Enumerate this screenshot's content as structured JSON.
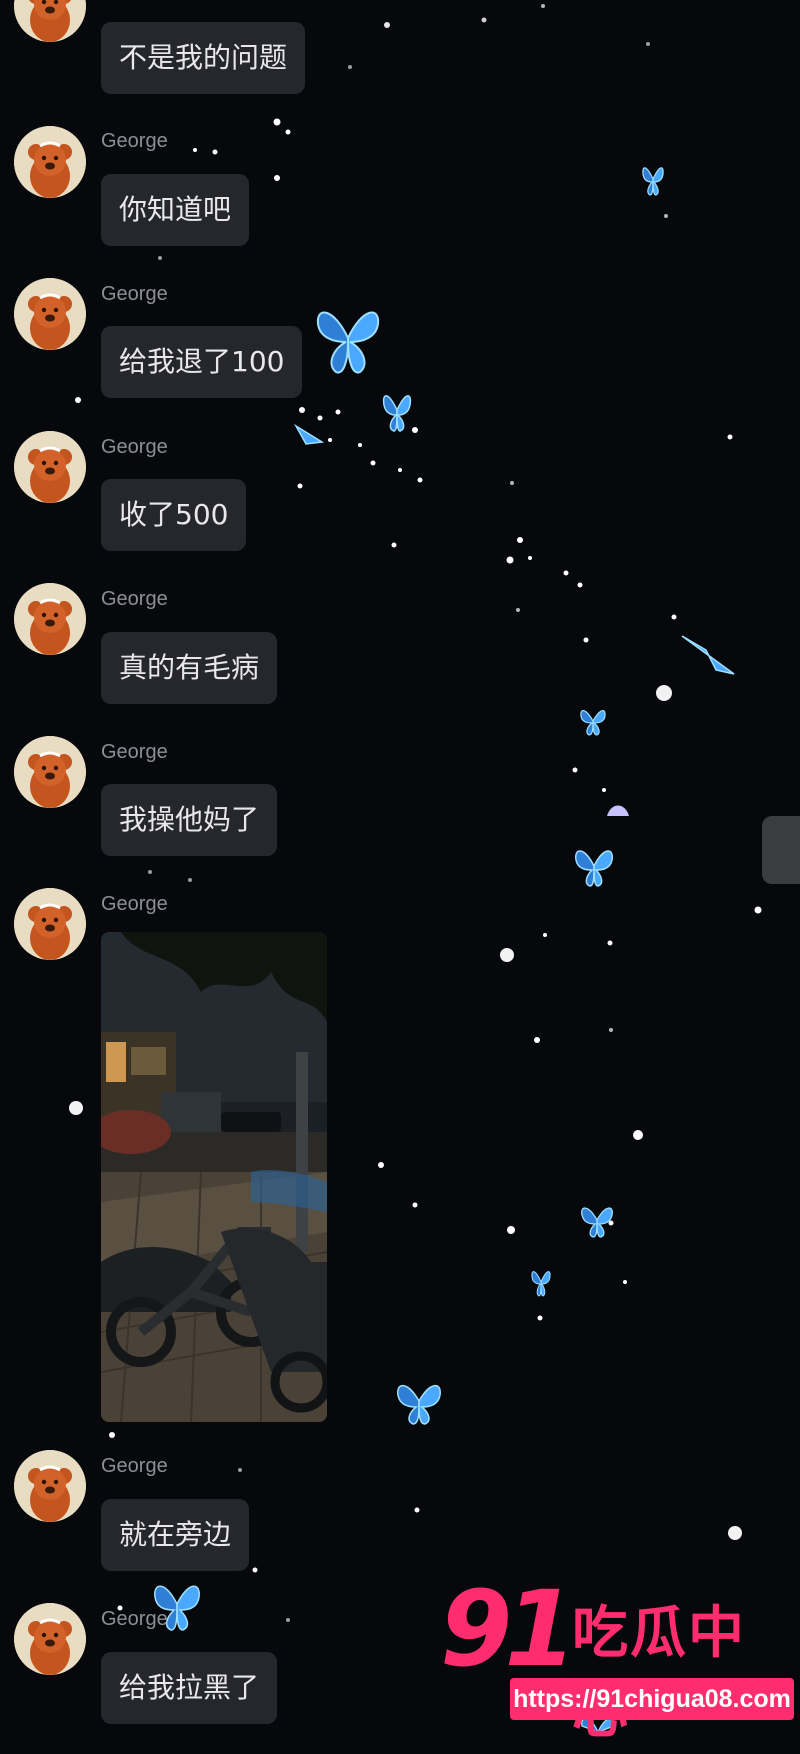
{
  "chat": {
    "messages": [
      {
        "sender": "",
        "text": "不是我的问题"
      },
      {
        "sender": "George",
        "text": "你知道吧"
      },
      {
        "sender": "George",
        "text": "给我退了100"
      },
      {
        "sender": "George",
        "text": "收了500"
      },
      {
        "sender": "George",
        "text": "真的有毛病"
      },
      {
        "sender": "George",
        "text": "我操他妈了"
      },
      {
        "sender": "George",
        "text": "[image]"
      },
      {
        "sender": "George",
        "text": "就在旁边"
      },
      {
        "sender": "George",
        "text": "给我拉黑了"
      }
    ]
  },
  "watermark": {
    "number": "91",
    "brand": "吃瓜中心",
    "url": "https://91chigua08.com"
  },
  "colors": {
    "background": "#07080c",
    "bubble": "#25272c",
    "bubble_text": "#e8e8ea",
    "sender_text": "#8c8f96",
    "watermark": "#ff2d6f",
    "butterfly": "#4aa8ff"
  }
}
